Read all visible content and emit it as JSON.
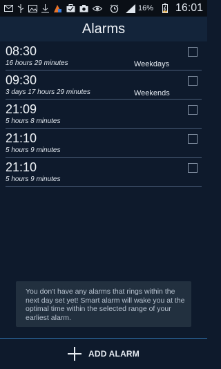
{
  "status_bar": {
    "icons": [
      "mail-icon",
      "usb-icon",
      "image-icon",
      "download-icon",
      "app-icon",
      "briefcase-icon",
      "camera-icon",
      "eye-icon",
      "alarm-clock-icon",
      "signal-icon"
    ],
    "battery_percent": "16%",
    "time": "16:01"
  },
  "app": {
    "title": "Alarms"
  },
  "alarms": [
    {
      "time": "08:30",
      "remaining": "16 hours 29 minutes",
      "repeat": "Weekdays",
      "enabled": false
    },
    {
      "time": "09:30",
      "remaining": "3 days 17 hours 29 minutes",
      "repeat": "Weekends",
      "enabled": false
    },
    {
      "time": "21:09",
      "remaining": "5 hours 8 minutes",
      "repeat": "",
      "enabled": false
    },
    {
      "time": "21:10",
      "remaining": "5 hours 9 minutes",
      "repeat": "",
      "enabled": false
    },
    {
      "time": "21:10",
      "remaining": "5 hours 9 minutes",
      "repeat": "",
      "enabled": false
    }
  ],
  "toast": {
    "message": "You don't have any alarms that rings within the next day set yet! Smart alarm will wake you at the optimal time within the selected range of your earliest alarm."
  },
  "bottom": {
    "add_label": "ADD ALARM"
  }
}
